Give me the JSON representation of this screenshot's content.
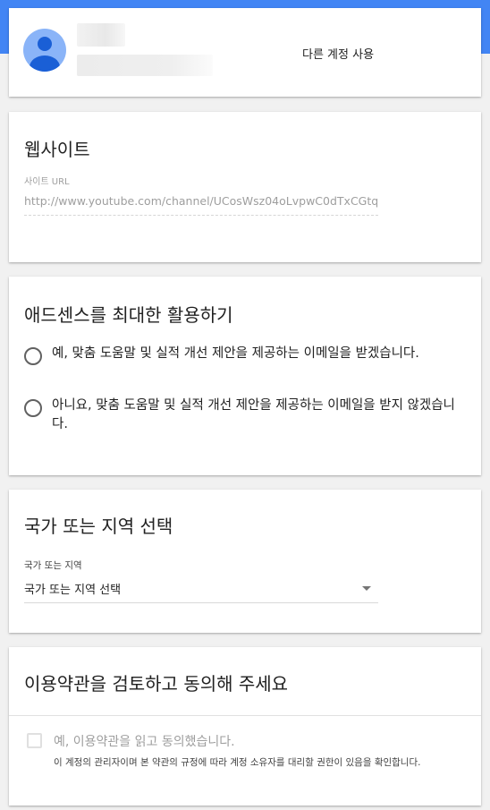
{
  "account": {
    "switch_label": "다른 계정 사용"
  },
  "website": {
    "title": "웹사이트",
    "url_label": "사이트 URL",
    "url_value": "http://www.youtube.com/channel/UCosWsz04oLvpwC0dTxCGtq"
  },
  "adsense": {
    "title": "애드센스를 최대한 활용하기",
    "options": [
      {
        "label": "예, 맞춤 도움말 및 실적 개선 제안을 제공하는 이메일을 받겠습니다."
      },
      {
        "label": "아니요, 맞춤 도움말 및 실적 개선 제안을 제공하는 이메일을 받지 않겠습니다."
      }
    ]
  },
  "country": {
    "title": "국가 또는 지역 선택",
    "field_label": "국가 또는 지역",
    "selected": "국가 또는 지역 선택"
  },
  "terms": {
    "title": "이용약관을 검토하고 동의해 주세요",
    "checkbox_label": "예, 이용약관을 읽고 동의했습니다.",
    "note": "이 계정의 관리자이며 본 약관의 규정에 따라 계정 소유자를 대리할 권한이 있음을 확인합니다."
  },
  "colors": {
    "accent": "#4285f4",
    "avatar_bg": "#8ab4f8",
    "avatar_fg": "#1a5fd6"
  }
}
